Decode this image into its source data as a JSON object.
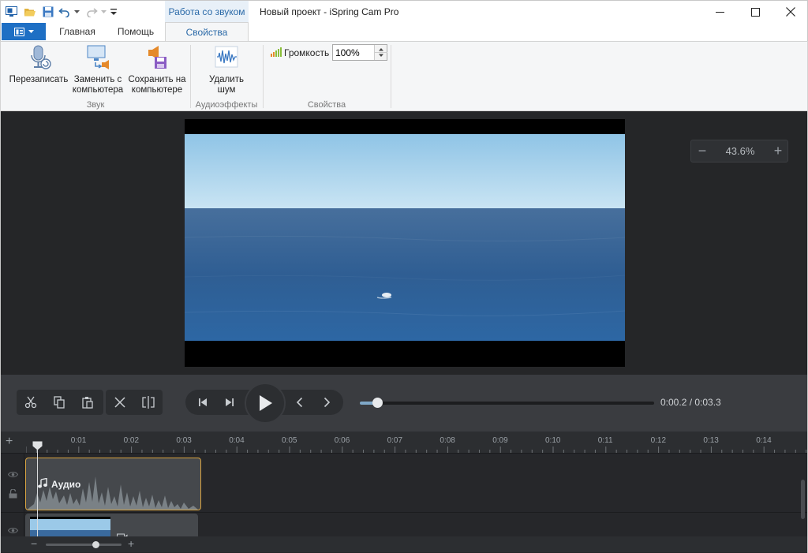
{
  "window": {
    "context_tab_label": "Работа со звуком",
    "title": "Новый проект - iSpring Cam Pro"
  },
  "tabs": [
    {
      "label": "Главная"
    },
    {
      "label": "Помощь"
    },
    {
      "label": "Свойства",
      "active": true
    }
  ],
  "ribbon": {
    "sound_group": {
      "label": "Звук",
      "rerecord": "Перезаписать",
      "replace_line1": "Заменить с",
      "replace_line2": "компьютера",
      "save_line1": "Сохранить на",
      "save_line2": "компьютере"
    },
    "audio_effects_group": {
      "label": "Аудиоэффекты",
      "remove_noise_line1": "Удалить",
      "remove_noise_line2": "шум"
    },
    "properties_group": {
      "label": "Свойства",
      "volume_label": "Громкость",
      "volume_value": "100%"
    }
  },
  "preview": {
    "zoom_value": "43.6%",
    "zoom_minus": "−",
    "zoom_plus": "+"
  },
  "player": {
    "time_readout": "0:00.2 / 0:03.3",
    "progress_fraction": 0.06
  },
  "timeline": {
    "ruler_labels": [
      "0:01",
      "0:02",
      "0:03",
      "0:04",
      "0:05",
      "0:06",
      "0:07",
      "0:08",
      "0:09",
      "0:10",
      "0:11",
      "0:12",
      "0:13",
      "0:14"
    ],
    "audio_clip_label": "Аудио",
    "add_track": "+",
    "zoom_fraction": 0.66,
    "zoom_minus": "−",
    "zoom_plus": "+"
  },
  "colors": {
    "accent": "#1e6fc4",
    "context_tab": "#2b6aa8",
    "audio_clip_border": "#d9a441",
    "workspace_bg": "#252628"
  }
}
